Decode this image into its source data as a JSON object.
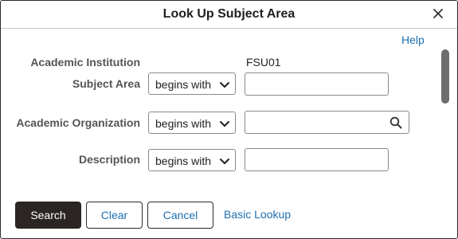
{
  "dialog": {
    "title": "Look Up Subject Area",
    "help_label": "Help"
  },
  "fields": {
    "institution": {
      "label": "Academic Institution",
      "value": "FSU01"
    },
    "subject_area": {
      "label": "Subject Area",
      "operator": "begins with",
      "value": ""
    },
    "academic_org": {
      "label": "Academic Organization",
      "operator": "begins with",
      "value": ""
    },
    "description": {
      "label": "Description",
      "operator": "begins with",
      "value": ""
    }
  },
  "buttons": {
    "search": "Search",
    "clear": "Clear",
    "cancel": "Cancel",
    "basic_lookup": "Basic Lookup"
  },
  "colors": {
    "link": "#1e6fb0",
    "primary_button": "#2b2623"
  },
  "icons": [
    "close-icon",
    "chevron-down-icon",
    "search-icon"
  ]
}
